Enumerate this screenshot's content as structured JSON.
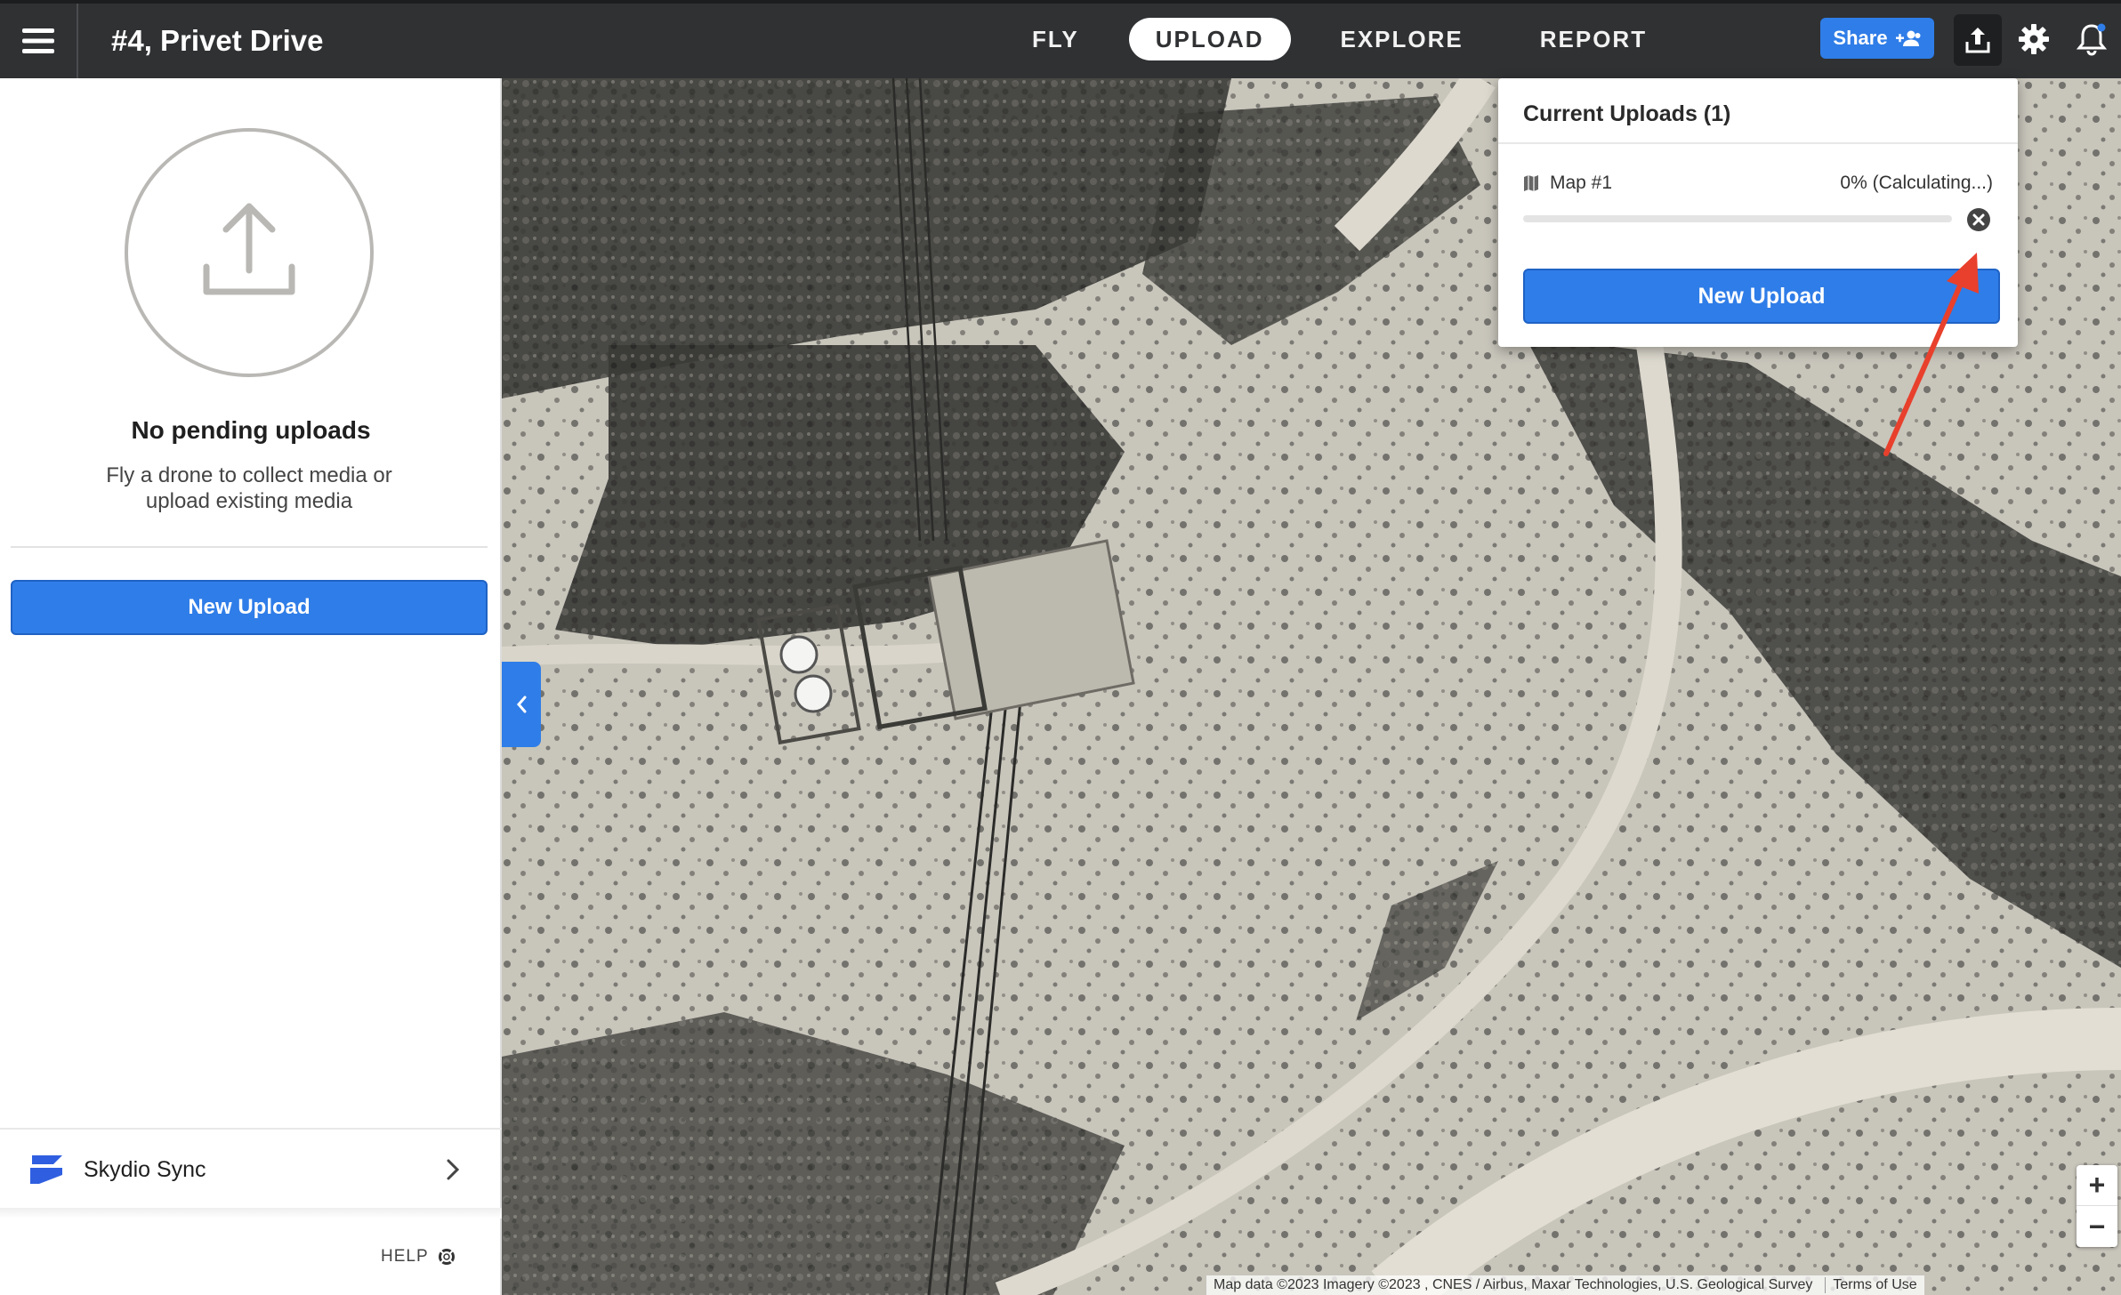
{
  "header": {
    "site_title": "#4, Privet Drive",
    "nav": [
      {
        "label": "FLY",
        "active": false
      },
      {
        "label": "UPLOAD",
        "active": true
      },
      {
        "label": "EXPLORE",
        "active": false
      },
      {
        "label": "REPORT",
        "active": false
      }
    ],
    "share_label": "Share",
    "icons": [
      "hamburger-menu-icon",
      "share-users-icon",
      "upload-icon",
      "gear-icon",
      "bell-icon"
    ]
  },
  "sidebar": {
    "empty_title": "No pending uploads",
    "empty_description": "Fly a drone to collect media or upload existing media",
    "new_upload_label": "New Upload",
    "sync_label": "Skydio Sync",
    "help_label": "HELP"
  },
  "popup": {
    "title": "Current Uploads (1)",
    "item": {
      "name": "Map #1",
      "status": "0% (Calculating...)",
      "progress": 0
    },
    "new_upload_label": "New Upload"
  },
  "map": {
    "attribution": "Map data ©2023 Imagery ©2023 , CNES / Airbus, Maxar Technologies, U.S. Geological Survey",
    "terms": "Terms of Use",
    "zoom_in": "+",
    "zoom_out": "−"
  },
  "colors": {
    "accent": "#2f7de8",
    "topbar": "#2f3133",
    "annotation_arrow": "#e8402c"
  }
}
